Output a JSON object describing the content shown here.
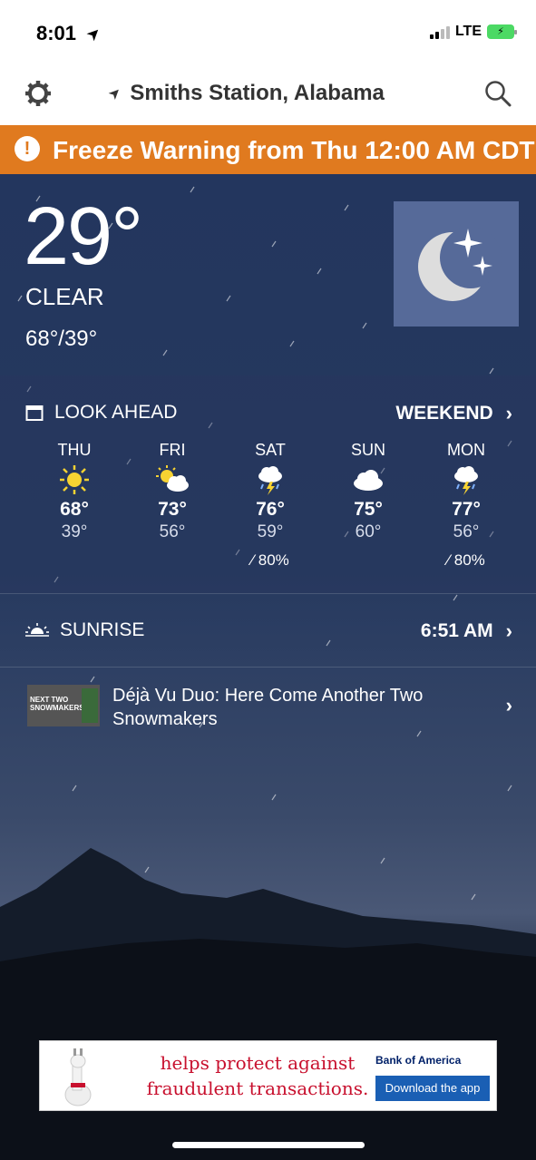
{
  "status_bar": {
    "time": "8:01",
    "network": "LTE"
  },
  "nav": {
    "location": "Smiths Station, Alabama"
  },
  "alert": {
    "text": "Freeze Warning from Thu 12:00 AM CDT"
  },
  "current": {
    "temp": "29°",
    "condition": "CLEAR",
    "hilo": "68°/39°",
    "icon": "moon-stars-icon"
  },
  "look_ahead": {
    "label": "LOOK AHEAD",
    "link": "WEEKEND",
    "days": [
      {
        "name": "THU",
        "hi": "68°",
        "lo": "39°",
        "precip": "",
        "icon": "sun-icon"
      },
      {
        "name": "FRI",
        "hi": "73°",
        "lo": "56°",
        "precip": "",
        "icon": "partly-cloudy-icon"
      },
      {
        "name": "SAT",
        "hi": "76°",
        "lo": "59°",
        "precip": "80%",
        "icon": "thunderstorm-icon"
      },
      {
        "name": "SUN",
        "hi": "75°",
        "lo": "60°",
        "precip": "",
        "icon": "cloudy-icon"
      },
      {
        "name": "MON",
        "hi": "77°",
        "lo": "56°",
        "precip": "80%",
        "icon": "thunderstorm-icon"
      }
    ]
  },
  "sunrise": {
    "label": "SUNRISE",
    "time": "6:51 AM"
  },
  "news": {
    "thumb_text": "NEXT TWO SNOWMAKERS",
    "title": "Déjà Vu Duo: Here Come Another Two Snowmakers"
  },
  "ad": {
    "line1": "helps protect against",
    "line2": "fraudulent transactions.",
    "brand": "Bank of America",
    "cta": "Download the app"
  },
  "colors": {
    "alert": "#e07a1f",
    "icon_tile": "#566a99",
    "ad_text": "#c8102e"
  }
}
